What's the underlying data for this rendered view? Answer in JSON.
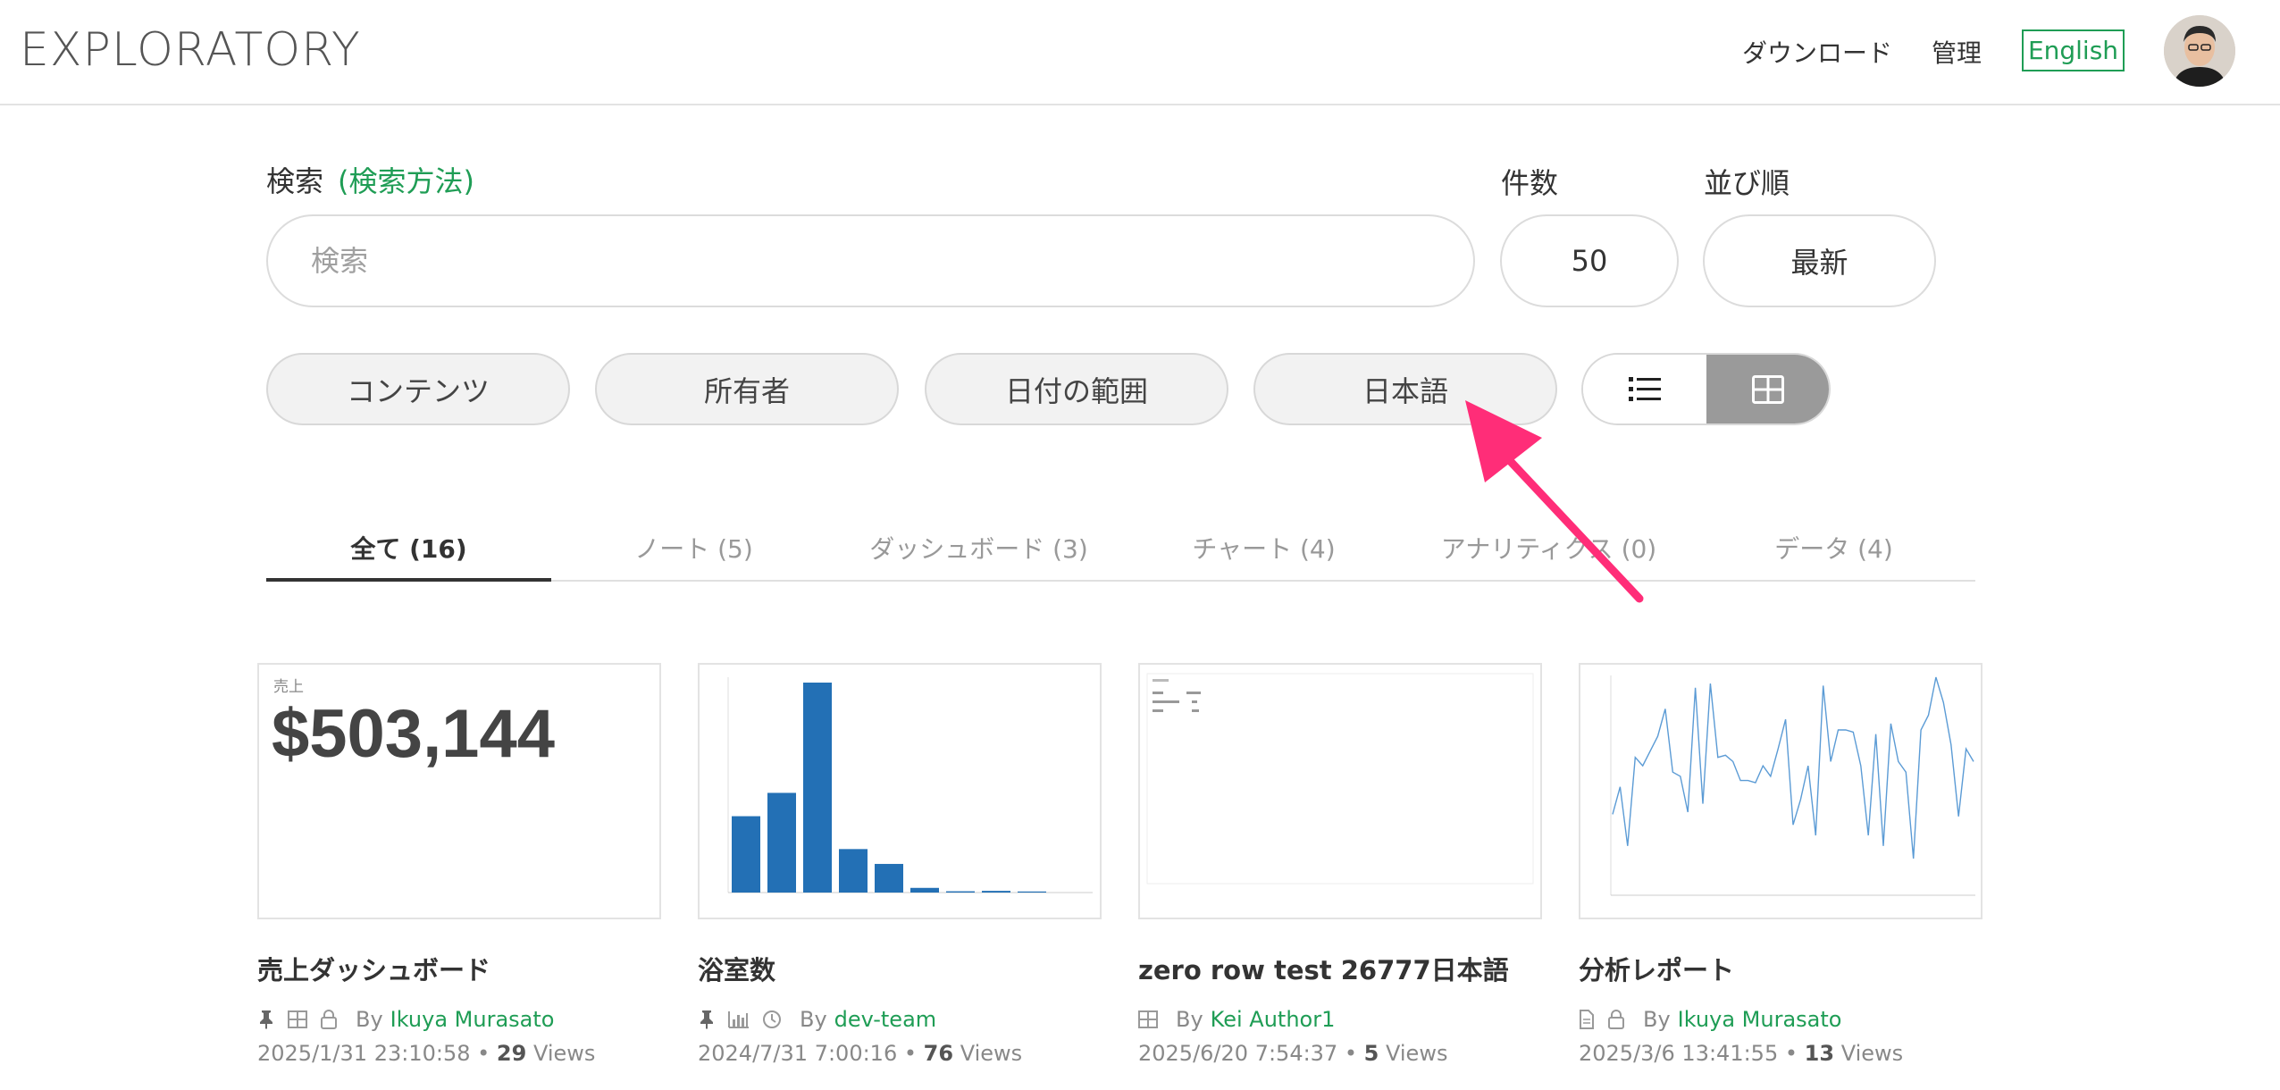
{
  "header": {
    "logo": "EXPLORATORY",
    "download": "ダウンロード",
    "admin": "管理",
    "language": "English"
  },
  "search": {
    "label": "検索",
    "help": "(検索方法)",
    "placeholder": "検索",
    "count_label": "件数",
    "count_value": "50",
    "sort_label": "並び順",
    "sort_value": "最新"
  },
  "filters": [
    "コンテンツ",
    "所有者",
    "日付の範囲",
    "日本語"
  ],
  "tabs": [
    {
      "label": "全て (16)",
      "active": true
    },
    {
      "label": "ノート (5)"
    },
    {
      "label": "ダッシュボード (3)"
    },
    {
      "label": "チャート (4)"
    },
    {
      "label": "アナリティクス (0)"
    },
    {
      "label": "データ (4)"
    }
  ],
  "cards": [
    {
      "title": "売上ダッシュボード",
      "by": "By",
      "author": "Ikuya Murasato",
      "date": "2025/1/31 23:10:58",
      "views": "29",
      "views_label": "Views",
      "kpi_label": "売上",
      "kpi_value": "$503,144",
      "icons": [
        "pin-icon",
        "grid-icon",
        "lock-icon"
      ]
    },
    {
      "title": "浴室数",
      "by": "By",
      "author": "dev-team",
      "date": "2024/7/31 7:00:16",
      "views": "76",
      "views_label": "Views",
      "icons": [
        "pin-icon",
        "chart-icon",
        "clock-icon"
      ]
    },
    {
      "title": "zero row test 26777日本語",
      "by": "By",
      "author": "Kei Author1",
      "date": "2025/6/20 7:54:37",
      "views": "5",
      "views_label": "Views",
      "icons": [
        "grid-icon"
      ]
    },
    {
      "title": "分析レポート",
      "by": "By",
      "author": "Ikuya Murasato",
      "date": "2025/3/6 13:41:55",
      "views": "13",
      "views_label": "Views",
      "icons": [
        "document-icon",
        "lock-icon"
      ]
    }
  ],
  "thumbnails": {
    "bar_values": [
      360,
      470,
      990,
      205,
      135,
      22,
      6,
      8,
      5
    ],
    "line_values": [
      35,
      48,
      20,
      62,
      58,
      65,
      72,
      85,
      55,
      53,
      36,
      95,
      40,
      97,
      62,
      63,
      60,
      51,
      51,
      50,
      58,
      53,
      66,
      80,
      30,
      42,
      58,
      25,
      96,
      60,
      75,
      75,
      74,
      58,
      25,
      73,
      20,
      78,
      60,
      55,
      14,
      75,
      82,
      100,
      88,
      68,
      34,
      66,
      60
    ]
  },
  "colors": {
    "accent": "#1f9d55",
    "bar": "#2370b5",
    "line": "#5b9bd5",
    "arrow": "#ff2d78"
  }
}
